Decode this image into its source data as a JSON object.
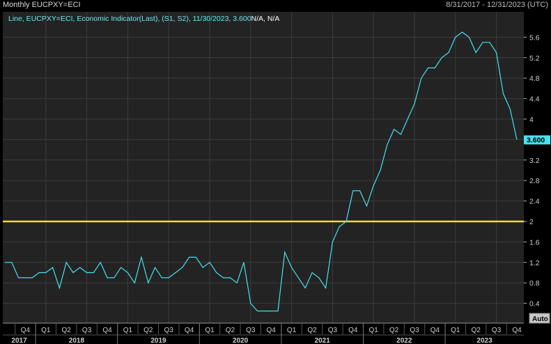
{
  "header": {
    "title": "Monthly EUCPXY=ECI",
    "range": "8/31/2017 - 12/31/2023 (UTC)"
  },
  "legend": {
    "text": "Line, EUCPXY=ECI, Economic Indicator(Last), (S1, S2), 11/30/2023, 3.600",
    "na": "N/A, N/A"
  },
  "last_value_label": "3.600",
  "auto_label": "Auto",
  "colors": {
    "background": "#000000",
    "plot_background": "#232323",
    "grid": "#3c3c3c",
    "series": "#47e2ee",
    "reference_line": "#f0e020",
    "last_value_box": "#47e2ee"
  },
  "chart_data": {
    "type": "line",
    "title": "Monthly EUCPXY=ECI",
    "x_unit": "month",
    "x_start": "2017-08",
    "ylim": [
      0,
      6
    ],
    "yticks": [
      "0.4",
      "0.8",
      "1.2",
      "1.6",
      "2",
      "2.4",
      "2.8",
      "3.2",
      "3.6",
      "4",
      "4.4",
      "4.8",
      "5.2",
      "5.6"
    ],
    "grid": true,
    "reference_line": 2.0,
    "quarter_labels": [
      "Q4",
      "Q1",
      "Q2",
      "Q3",
      "Q4",
      "Q1",
      "Q2",
      "Q3",
      "Q4",
      "Q1",
      "Q2",
      "Q3",
      "Q4",
      "Q1",
      "Q2",
      "Q3",
      "Q4",
      "Q1",
      "Q2",
      "Q3",
      "Q4",
      "Q1",
      "Q2",
      "Q3",
      "Q4"
    ],
    "year_labels": [
      "2017",
      "2018",
      "2019",
      "2020",
      "2021",
      "2022",
      "2023"
    ],
    "series": [
      {
        "values": [
          1.2,
          1.2,
          0.9,
          0.9,
          0.9,
          1.0,
          1.0,
          1.1,
          0.7,
          1.2,
          1.0,
          1.1,
          1.0,
          1.0,
          1.2,
          0.9,
          0.9,
          1.1,
          1.0,
          0.8,
          1.3,
          0.8,
          1.1,
          0.9,
          0.9,
          1.0,
          1.1,
          1.3,
          1.3,
          1.1,
          1.2,
          1.0,
          0.9,
          0.9,
          0.8,
          1.2,
          0.4,
          0.25,
          0.25,
          0.25,
          0.25,
          1.4,
          1.1,
          0.9,
          0.7,
          1.0,
          0.9,
          0.7,
          1.6,
          1.9,
          2.0,
          2.6,
          2.6,
          2.3,
          2.7,
          3.0,
          3.5,
          3.8,
          3.7,
          4.0,
          4.3,
          4.8,
          5.0,
          5.0,
          5.2,
          5.3,
          5.6,
          5.7,
          5.6,
          5.3,
          5.5,
          5.5,
          5.3,
          4.5,
          4.2,
          3.6
        ]
      }
    ]
  }
}
